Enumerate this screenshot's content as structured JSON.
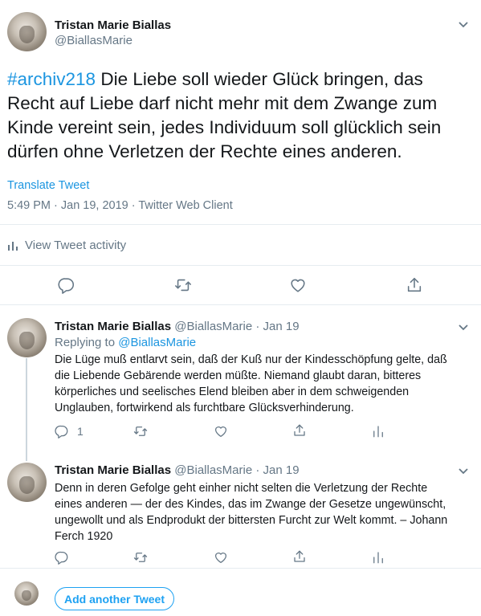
{
  "main_tweet": {
    "author_name": "Tristan Marie Biallas",
    "author_handle": "@BiallasMarie",
    "hashtag": "#archiv218",
    "text": " Die Liebe soll wieder Glück bringen, das Recht auf Liebe darf nicht mehr mit dem Zwange zum Kinde vereint sein, jedes Individuum soll glücklich sein dürfen ohne Verletzen der Rechte eines anderen.",
    "translate_label": "Translate Tweet",
    "meta": "5:49 PM · Jan 19, 2019 · Twitter Web Client",
    "activity_label": "View Tweet activity",
    "icons": {
      "caret": "chevron-down-icon",
      "reply": "reply-icon",
      "retweet": "retweet-icon",
      "like": "like-icon",
      "share": "share-icon",
      "activity": "analytics-icon"
    }
  },
  "replies": [
    {
      "author_name": "Tristan Marie Biallas",
      "author_handle": "@BiallasMarie",
      "date": "Jan 19",
      "replying_prefix": "Replying to",
      "replying_to": "@BiallasMarie",
      "text": "Die Lüge muß entlarvt sein, daß der Kuß nur der Kindesschöpfung gelte, daß die  Liebende Gebärende werden müßte. Niemand glaubt daran, bitteres körperliches und seelisches Elend bleiben aber in dem schweigenden Unglauben, fortwirkend als furchtbare Glücksverhinderung.",
      "reply_count": "1"
    },
    {
      "author_name": "Tristan Marie Biallas",
      "author_handle": "@BiallasMarie",
      "date": "Jan 19",
      "text": "Denn in deren Gefolge geht einher nicht selten die Verletzung der  Rechte eines anderen — der des Kindes, das im Zwange der Gesetze  ungewünscht, ungewollt und als Endprodukt der bittersten Furcht zur Welt  kommt. – Johann Ferch 1920"
    }
  ],
  "compose": {
    "add_tweet_label": "Add another Tweet"
  },
  "colors": {
    "accent": "#1da1f2",
    "link": "#1b95e0",
    "secondary_text": "#657786",
    "divider": "#e6ecf0"
  }
}
